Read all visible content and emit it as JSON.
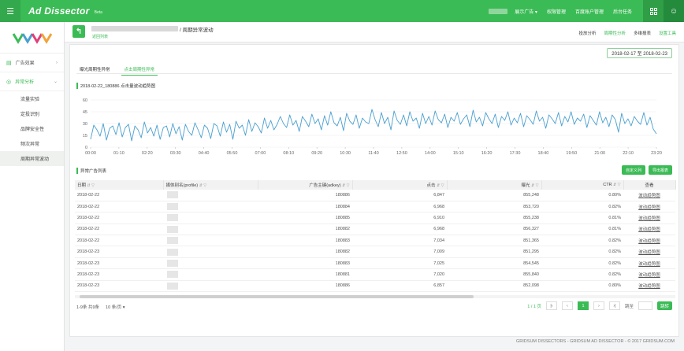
{
  "app": {
    "name": "Ad Dissector",
    "badge": "Beta"
  },
  "topnav": {
    "items": [
      "展示广告 ▾",
      "权限管理",
      "百度账户管理",
      "后台任务"
    ]
  },
  "sidebar": {
    "groups": [
      {
        "label": "广告效果",
        "open": false
      },
      {
        "label": "异常分析",
        "open": true
      }
    ],
    "subitems": [
      "流量实验",
      "定投识别",
      "品牌安全性",
      "频次异常",
      "周期异常波动"
    ],
    "active_index": 4
  },
  "breadcrumb": {
    "title": "/ 周期异常波动",
    "sub": "返回列表"
  },
  "header_links": [
    "投放分析",
    "周期性分析",
    "多维报表",
    "设置工具"
  ],
  "date_range": "2018-02-17 至 2018-02-23",
  "tabs": [
    "曝光周期性异常",
    "点击周期性异常"
  ],
  "active_tab": 1,
  "chart_title": "2018-02-22_180886 点击量波动趋势图",
  "chart_data": {
    "type": "line",
    "color": "#4a9fd0",
    "ylim": [
      0,
      60
    ],
    "yticks": [
      0,
      15,
      30,
      45,
      60
    ],
    "xticks": [
      "00:00",
      "01:10",
      "02:20",
      "03:30",
      "04:40",
      "05:50",
      "07:00",
      "08:10",
      "09:20",
      "10:30",
      "11:40",
      "12:50",
      "14:00",
      "15:10",
      "16:20",
      "17:30",
      "18:40",
      "19:50",
      "21:00",
      "22:10",
      "23:20"
    ],
    "values": [
      10,
      28,
      22,
      14,
      30,
      9,
      24,
      27,
      16,
      31,
      13,
      25,
      29,
      8,
      27,
      22,
      12,
      32,
      18,
      25,
      14,
      28,
      10,
      25,
      27,
      13,
      30,
      17,
      26,
      9,
      29,
      20,
      15,
      31,
      22,
      12,
      28,
      24,
      11,
      30,
      27,
      14,
      32,
      19,
      29,
      10,
      33,
      24,
      28,
      15,
      35,
      20,
      31,
      26,
      18,
      37,
      24,
      34,
      22,
      29,
      39,
      30,
      25,
      41,
      28,
      34,
      20,
      39,
      33,
      26,
      42,
      30,
      36,
      22,
      40,
      28,
      45,
      31,
      27,
      38,
      21,
      43,
      33,
      29,
      41,
      24,
      37,
      32,
      30,
      48,
      35,
      26,
      44,
      30,
      38,
      22,
      46,
      34,
      29,
      41,
      27,
      45,
      33,
      37,
      24,
      43,
      30,
      39,
      28,
      46,
      35,
      31,
      42,
      25,
      38,
      33,
      44,
      29,
      36,
      41,
      26,
      47,
      32,
      38,
      27,
      44,
      36,
      30,
      42,
      25,
      39,
      34,
      45,
      28,
      37,
      31,
      43,
      26,
      40,
      35,
      29,
      46,
      33,
      38,
      24,
      41,
      36,
      30,
      44,
      27,
      39,
      32,
      45,
      29,
      37,
      33,
      42,
      25,
      40,
      34,
      28,
      45,
      31,
      38,
      26,
      41,
      35,
      19,
      43,
      30,
      36,
      27,
      39,
      33,
      29,
      44,
      28,
      38,
      23,
      17
    ]
  },
  "list_title": "异常广告列表",
  "buttons": {
    "custom_columns": "自定义列",
    "export": "导出报表"
  },
  "table": {
    "headers": [
      "日期",
      "媒体别名(profile)",
      "广告主键(adkey)",
      "点击",
      "曝光",
      "CTR",
      "查看"
    ],
    "rows": [
      [
        "2018-02-22",
        "",
        "180886",
        "6,847",
        "855,248",
        "0.80%",
        "波动趋势图"
      ],
      [
        "2018-02-22",
        "",
        "180884",
        "6,968",
        "853,720",
        "0.82%",
        "波动趋势图"
      ],
      [
        "2018-02-22",
        "",
        "180885",
        "6,910",
        "855,238",
        "0.81%",
        "波动趋势图"
      ],
      [
        "2018-02-22",
        "",
        "180882",
        "6,968",
        "856,327",
        "0.81%",
        "波动趋势图"
      ],
      [
        "2018-02-22",
        "",
        "180883",
        "7,034",
        "851,365",
        "0.82%",
        "波动趋势图"
      ],
      [
        "2018-02-23",
        "",
        "180882",
        "7,009",
        "851,295",
        "0.82%",
        "波动趋势图"
      ],
      [
        "2018-02-23",
        "",
        "180883",
        "7,025",
        "854,545",
        "0.82%",
        "波动趋势图"
      ],
      [
        "2018-02-23",
        "",
        "180881",
        "7,020",
        "855,840",
        "0.82%",
        "波动趋势图"
      ],
      [
        "2018-02-23",
        "",
        "180886",
        "6,857",
        "852,098",
        "0.80%",
        "波动趋势图"
      ]
    ]
  },
  "pager": {
    "summary": "1-9条 共9条",
    "page_size": "10 条/页 ▾",
    "pages": "1 / 1 页",
    "goto": "跳至",
    "go": "跳转"
  },
  "footer": "GRIDSUM DISSECTORS - GRIDSUM AD DISSECTOR - © 2017 GRIDSUM.COM"
}
